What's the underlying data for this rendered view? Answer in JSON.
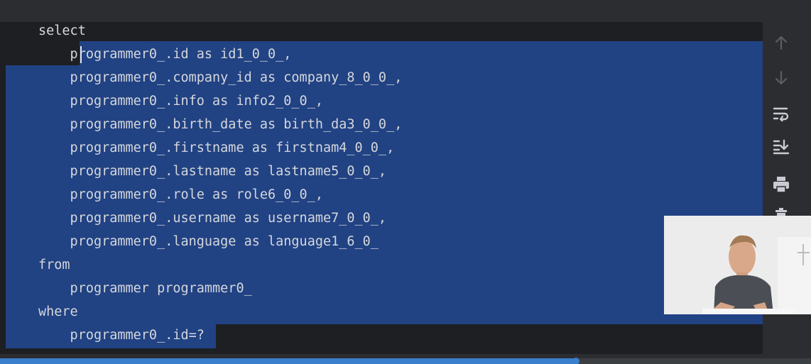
{
  "editor": {
    "lines": [
      "select",
      "    programmer0_.id as id1_0_0_,",
      "    programmer0_.company_id as company_8_0_0_,",
      "    programmer0_.info as info2_0_0_,",
      "    programmer0_.birth_date as birth_da3_0_0_,",
      "    programmer0_.firstname as firstnam4_0_0_,",
      "    programmer0_.lastname as lastname5_0_0_,",
      "    programmer0_.role as role6_0_0_,",
      "    programmer0_.username as username7_0_0_,",
      "    programmer0_.language as language1_6_0_",
      "from",
      "    programmer programmer0_",
      "where",
      "    programmer0_.id=?"
    ]
  },
  "toolbar": {
    "icons": [
      "arrow-up-icon",
      "arrow-down-icon",
      "soft-wrap-icon",
      "scroll-to-end-icon",
      "print-icon",
      "trash-icon"
    ]
  },
  "video": {
    "progress": 0.71
  },
  "colors": {
    "selection": "#214283",
    "editor_bg": "#1e1f22",
    "text": "#d4d7dc",
    "accent": "#3a7fce"
  }
}
